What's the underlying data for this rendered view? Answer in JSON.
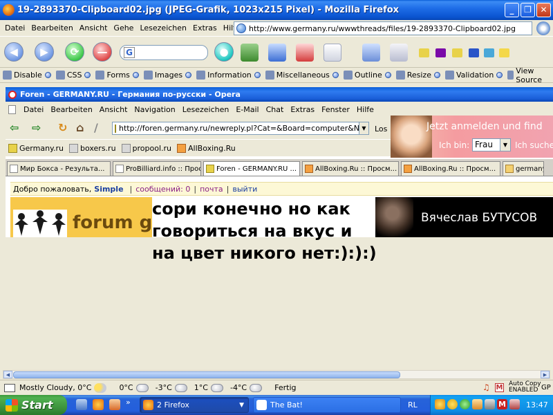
{
  "firefox": {
    "title": "19-2893370-Clipboard02.jpg (JPEG-Grafik, 1023x215 Pixel) - Mozilla Firefox",
    "menu": [
      "Datei",
      "Bearbeiten",
      "Ansicht",
      "Gehe",
      "Lesezeichen",
      "Extras",
      "Hilfe"
    ],
    "url": "http://www.germany.ru/wwwthreads/files/19-2893370-Clipboard02.jpg",
    "search_logo": "G",
    "extensions": [
      "Disable",
      "CSS",
      "Forms",
      "Images",
      "Information",
      "Miscellaneous",
      "Outline",
      "Resize",
      "Validation",
      "View Source"
    ]
  },
  "opera": {
    "title": "Foren - GERMANY.RU - Германия по-русски - Opera",
    "menu": [
      "Datei",
      "Bearbeiten",
      "Ansicht",
      "Navigation",
      "Lesezeichen",
      "E-Mail",
      "Chat",
      "Extras",
      "Fenster",
      "Hilfe"
    ],
    "url": "http://foren.germany.ru/newreply.pl?Cat=&Board=computer&Numb",
    "go_label": "Los",
    "ad": {
      "line1": "Jetzt anmelden und find",
      "ich_bin": "Ich bin:",
      "select": "Frau",
      "suche": "Ich suche"
    },
    "links": [
      "Germany.ru",
      "boxers.ru",
      "propool.ru",
      "AllBoxing.Ru"
    ],
    "tabs": [
      "Мир Бокса - Результа...",
      "ProBilliard.info :: Прос...",
      "Foren - GERMANY.RU ...",
      "AllBoxing.Ru :: Просм...",
      "AllBoxing.Ru :: Просм...",
      "germany"
    ],
    "welcome": {
      "greeting": "Добро пожаловать,",
      "user": "Simple",
      "messages": "сообщений: 0",
      "mail": "почта",
      "exit": "выйти"
    },
    "forum_logo": "forum ge",
    "banner": "Вячеслав  БУТУСОВ"
  },
  "caption": {
    "line1": "сори конечно но как",
    "line2": "говориться на вкус и",
    "line3": "на цвет никого нет:):):)"
  },
  "status": {
    "weather": "Mostly Cloudy, 0°C",
    "t1": "0°C",
    "t2": "-3°C",
    "t3": "1°C",
    "t4": "-4°C",
    "state": "Fertig",
    "autocopy_1": "Auto Copy",
    "autocopy_2": "ENABLED",
    "gp": "GP"
  },
  "taskbar": {
    "start": "Start",
    "task_firefox": "2 Firefox",
    "task_bat": "The Bat!",
    "lang": "RL",
    "clock": "13:47"
  }
}
